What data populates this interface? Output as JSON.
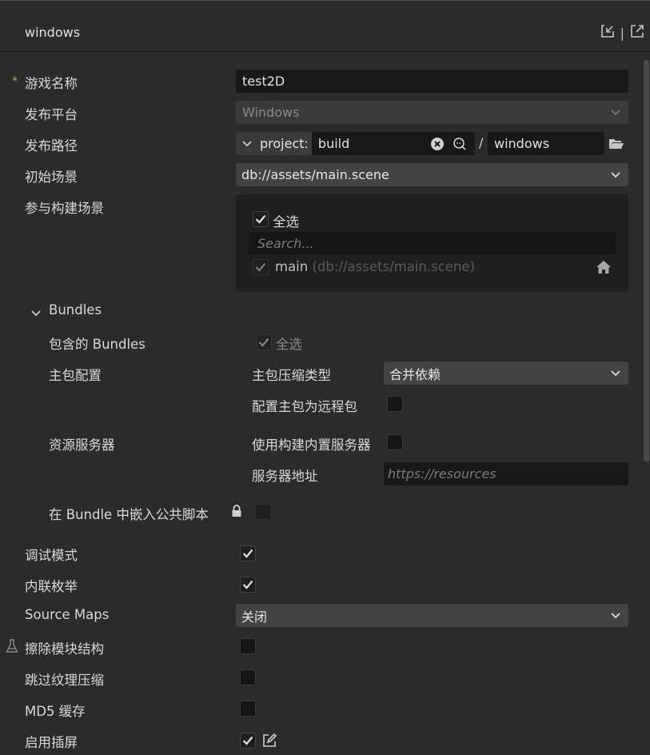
{
  "window": {
    "title": "windows",
    "icons": [
      "import-icon",
      "export-icon"
    ],
    "separator": "|"
  },
  "general": {
    "game_name": {
      "label": "游戏名称",
      "required_mark": "*",
      "value": "test2D"
    },
    "platform": {
      "label": "发布平台",
      "value": "Windows"
    },
    "build_path": {
      "label": "发布路径",
      "prefix": "project:",
      "value": "build",
      "slash": "/",
      "folder": "windows"
    },
    "start_scene": {
      "label": "初始场景",
      "value": "db://assets/main.scene"
    },
    "scenes": {
      "label": "参与构建场景",
      "select_all": "全选",
      "search_placeholder": "Search...",
      "items": [
        {
          "name": "main",
          "path": "(db://assets/main.scene)",
          "checked": true
        }
      ]
    }
  },
  "bundles": {
    "title": "Bundles",
    "included": {
      "label": "包含的 Bundles",
      "select_all": "全选"
    },
    "main_pkg": {
      "label": "主包配置",
      "compress_label": "主包压缩类型",
      "compress_value": "合并依赖",
      "remote_label": "配置主包为远程包"
    },
    "server": {
      "label": "资源服务器",
      "builtin_label": "使用构建内置服务器",
      "address_label": "服务器地址",
      "address_placeholder": "https://resources"
    },
    "embed": {
      "label": "在 Bundle 中嵌入公共脚本"
    }
  },
  "options": {
    "debug": {
      "label": "调试模式",
      "checked": true
    },
    "inline_enum": {
      "label": "内联枚举",
      "checked": true
    },
    "source_maps": {
      "label": "Source Maps",
      "value": "关闭"
    },
    "mangle": {
      "label": "擦除模块结构",
      "checked": false
    },
    "skip_texture": {
      "label": "跳过纹理压缩",
      "checked": false
    },
    "md5": {
      "label": "MD5 缓存",
      "checked": false
    },
    "splash": {
      "label": "启用插屏",
      "checked": true
    }
  },
  "colors": {
    "accent": "#e0a020",
    "background": "#2b2b2b",
    "input_bg": "#181818",
    "select_bg": "#434343"
  }
}
